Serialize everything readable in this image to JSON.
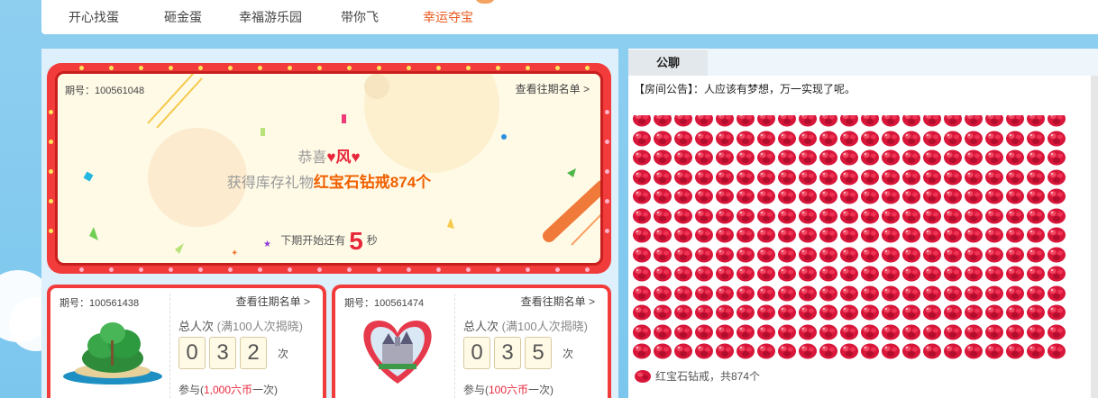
{
  "nav": {
    "items": [
      {
        "label": "开心找蛋"
      },
      {
        "label": "砸金蛋"
      },
      {
        "label": "幸福游乐园"
      },
      {
        "label": "带你飞"
      },
      {
        "label": "幸运夺宝"
      }
    ],
    "active": "幸运夺宝"
  },
  "main_draw": {
    "issue_label": "期号：100561048",
    "history_link": "查看往期名单 >",
    "congrats_prefix": "恭喜",
    "winner": "♥风♥",
    "prize_prefix": "获得库存礼物",
    "prize": "红宝石钻戒874个",
    "countdown_prefix": "下期开始还有",
    "countdown_value": "5",
    "countdown_unit": "秒"
  },
  "cards": [
    {
      "issue_label": "期号：100561438",
      "history_link": "查看往期名单 >",
      "total_label": "总人次",
      "total_note": "(满100人次揭晓)",
      "digits": [
        "0",
        "3",
        "2"
      ],
      "unit": "次",
      "join_prefix": "参与(",
      "join_price": "1,000六币",
      "join_suffix": "一次)",
      "thumb_icon": "island-icon"
    },
    {
      "issue_label": "期号：100561474",
      "history_link": "查看往期名单 >",
      "total_label": "总人次",
      "total_note": "(满100人次揭晓)",
      "digits": [
        "0",
        "3",
        "5"
      ],
      "unit": "次",
      "join_prefix": "参与(",
      "join_price": "100六币",
      "join_suffix": "一次)",
      "thumb_icon": "castle-heart-icon"
    }
  ],
  "chat": {
    "tab_label": "公聊",
    "notice": "【房间公告】：人应该有梦想，万一实现了呢。",
    "gift_icon": "ruby-ring-icon",
    "gift_count": 874,
    "gift_caption": "红宝石钻戒，共874个"
  },
  "colors": {
    "frame_red": "#f23b3b",
    "accent_orange": "#e85a1e",
    "winner_red": "#e8263a",
    "background_blue": "#8ecff0"
  }
}
